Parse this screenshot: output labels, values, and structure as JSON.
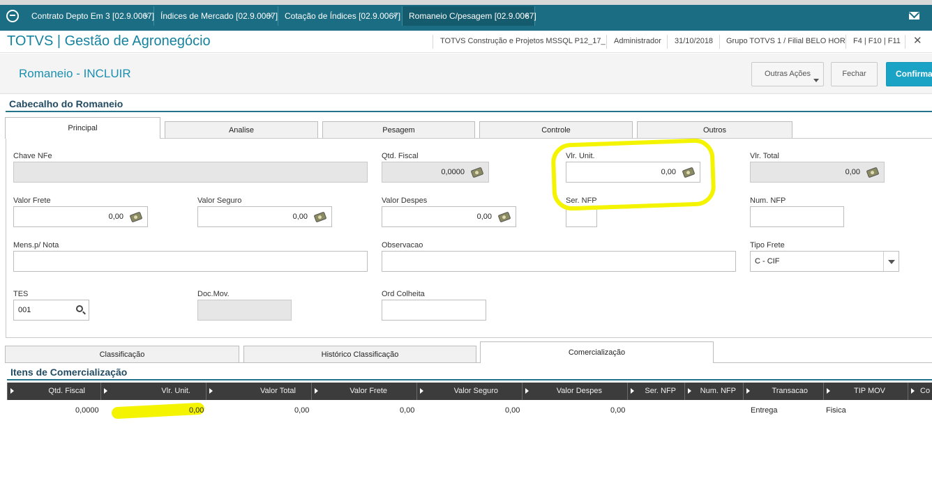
{
  "tabs": [
    {
      "label": "Contrato Depto Em 3 [02.9.0067]",
      "close": "×"
    },
    {
      "label": "Índices de Mercado [02.9.0067]",
      "close": "×"
    },
    {
      "label": "Cotação de Índices [02.9.0067]",
      "close": "×"
    },
    {
      "label": "Romaneio C/pesagem [02.9.0067]",
      "close": "×"
    }
  ],
  "header": {
    "brand": "TOTVS | Gestão de Agronegócio",
    "company": "TOTVS Construção e Projetos MSSQL P12_17_",
    "user": "Administrador",
    "date": "31/10/2018",
    "branch": "Grupo TOTVS 1 / Filial BELO HOR",
    "shortcuts": "F4 | F10 | F11",
    "close": "✕"
  },
  "page": {
    "title": "Romaneio - INCLUIR",
    "buttons": {
      "other_actions": "Outras Ações",
      "close": "Fechar",
      "confirm": "Confirmar"
    }
  },
  "header_section": {
    "title": "Cabecalho do Romaneio",
    "tabs": [
      "Principal",
      "Analise",
      "Pesagem",
      "Controle",
      "Outros"
    ]
  },
  "form": {
    "chave_nfe": {
      "label": "Chave NFe",
      "value": ""
    },
    "qtd_fiscal": {
      "label": "Qtd. Fiscal",
      "value": "0,0000"
    },
    "vlr_unit": {
      "label": "Vlr. Unit.",
      "value": "0,00"
    },
    "vlr_total": {
      "label": "Vlr. Total",
      "value": "0,00"
    },
    "valor_frete": {
      "label": "Valor Frete",
      "value": "0,00"
    },
    "valor_seguro": {
      "label": "Valor Seguro",
      "value": "0,00"
    },
    "valor_despes": {
      "label": "Valor Despes",
      "value": "0,00"
    },
    "ser_nfp": {
      "label": "Ser. NFP",
      "value": ""
    },
    "num_nfp": {
      "label": "Num. NFP",
      "value": ""
    },
    "mens_nota": {
      "label": "Mens.p/ Nota",
      "value": ""
    },
    "observacao": {
      "label": "Observacao",
      "value": ""
    },
    "tipo_frete": {
      "label": "Tipo Frete",
      "value": "C - CIF"
    },
    "tes": {
      "label": "TES",
      "value": "001"
    },
    "doc_mov": {
      "label": "Doc.Mov.",
      "value": ""
    },
    "ord_colheita": {
      "label": "Ord Colheita",
      "value": ""
    }
  },
  "bottom_tabs": [
    "Classificação",
    "Histórico Classificação",
    "Comercialização"
  ],
  "items": {
    "title": "Itens de Comercialização",
    "columns": [
      "Qtd. Fiscal",
      "Vlr. Unit.",
      "Valor Total",
      "Valor Frete",
      "Valor Seguro",
      "Valor Despes",
      "Ser. NFP",
      "Num. NFP",
      "Transacao",
      "TIP MOV",
      "Co"
    ],
    "rows": [
      [
        "0,0000",
        "0,00",
        "0,00",
        "0,00",
        "0,00",
        "0,00",
        "",
        "",
        "Entrega",
        "Fisica"
      ]
    ]
  },
  "colors": {
    "accent": "#1b6d83",
    "primary_button": "#1aa3c5",
    "highlight": "#f4f400"
  }
}
